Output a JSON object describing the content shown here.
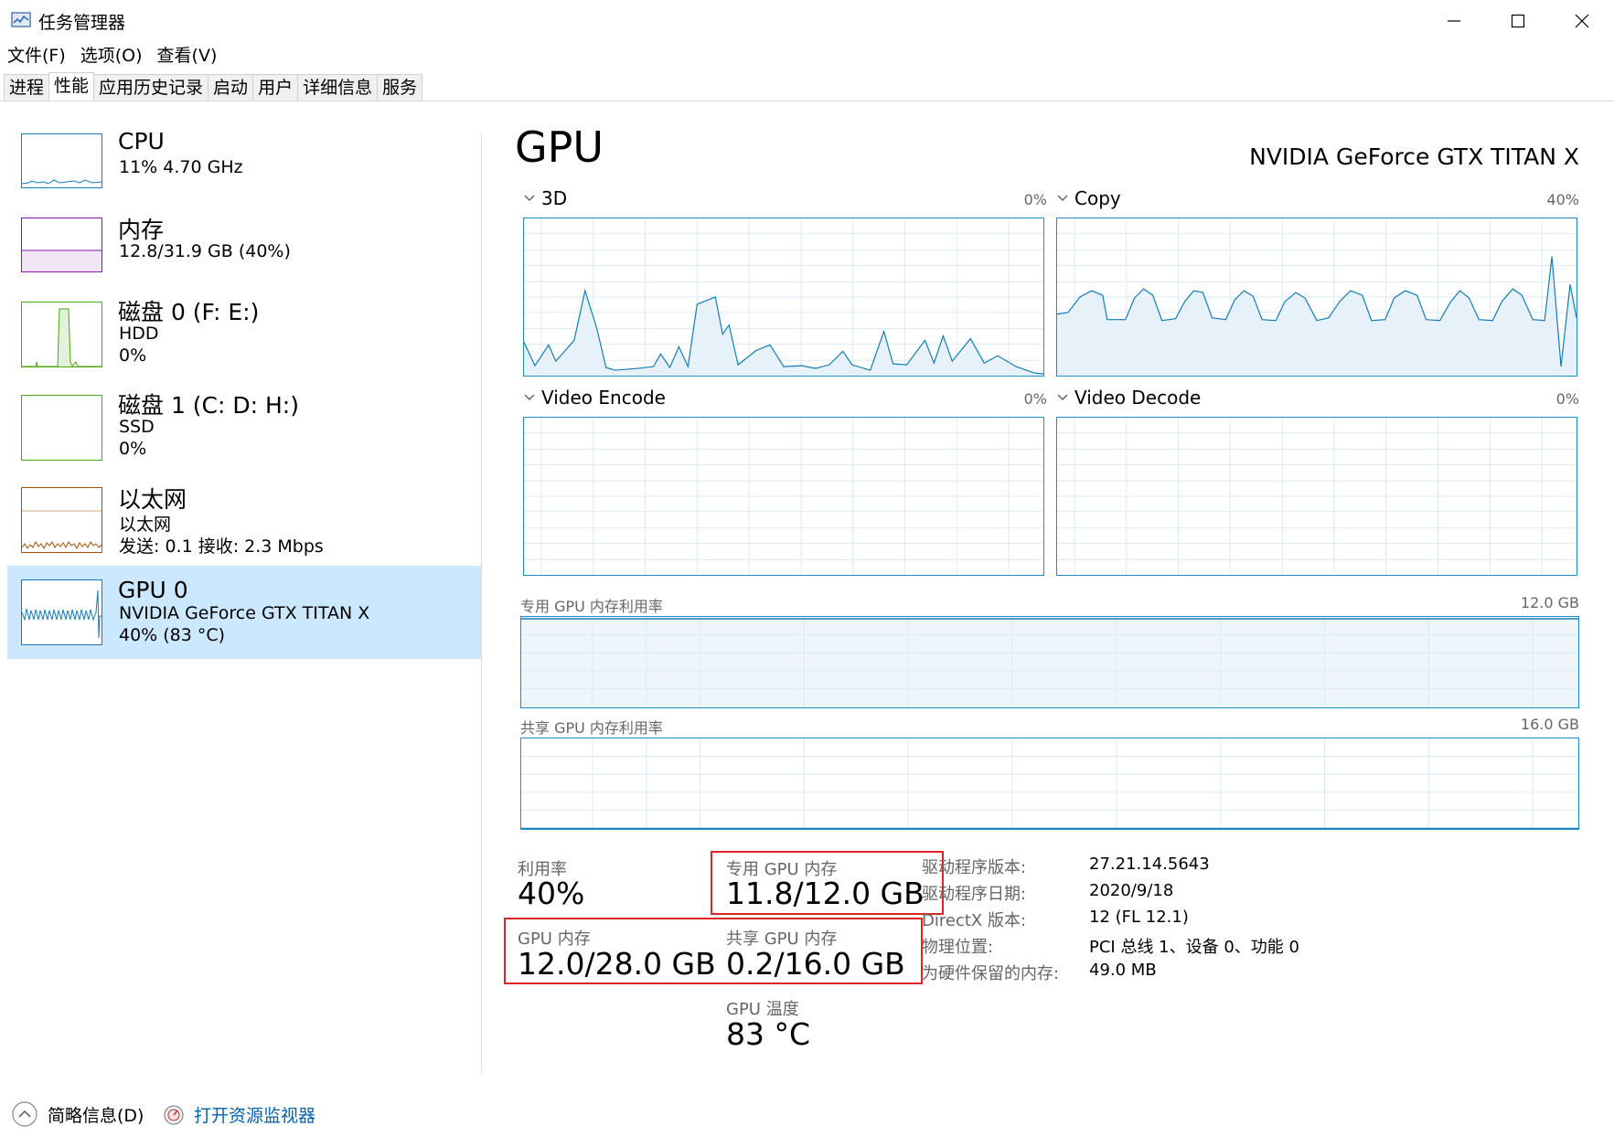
{
  "window": {
    "title": "任务管理器"
  },
  "menu": [
    "文件(F)",
    "选项(O)",
    "查看(V)"
  ],
  "tabs": [
    "进程",
    "性能",
    "应用历史记录",
    "启动",
    "用户",
    "详细信息",
    "服务"
  ],
  "sidebar": {
    "items": [
      {
        "title": "CPU",
        "lines": [
          "11%  4.70 GHz"
        ],
        "color": "#117dbb"
      },
      {
        "title": "内存",
        "lines": [
          "12.8/31.9 GB (40%)"
        ],
        "color": "#8b12ae"
      },
      {
        "title": "磁盘 0 (F: E:)",
        "lines": [
          "HDD",
          "0%"
        ],
        "color": "#4da60c"
      },
      {
        "title": "磁盘 1 (C: D: H:)",
        "lines": [
          "SSD",
          "0%"
        ],
        "color": "#4da60c"
      },
      {
        "title": "以太网",
        "lines": [
          "以太网",
          "发送: 0.1  接收: 2.3 Mbps"
        ],
        "color": "#a74f01"
      },
      {
        "title": "GPU 0",
        "lines": [
          "NVIDIA GeForce GTX TITAN X",
          "40% (83 °C)"
        ],
        "color": "#117dbb"
      }
    ]
  },
  "gpu": {
    "title": "GPU",
    "model": "NVIDIA GeForce GTX TITAN X",
    "engines": [
      {
        "name": "3D",
        "pct": "0%"
      },
      {
        "name": "Copy",
        "pct": "40%"
      },
      {
        "name": "Video Encode",
        "pct": "0%"
      },
      {
        "name": "Video Decode",
        "pct": "0%"
      }
    ],
    "dedicated_mem": {
      "label": "专用 GPU 内存利用率",
      "max": "12.0 GB",
      "fill": 0.98
    },
    "shared_mem": {
      "label": "共享 GPU 内存利用率",
      "max": "16.0 GB",
      "fill": 0.0125
    },
    "stats": {
      "utilization": {
        "label": "利用率",
        "value": "40%"
      },
      "dedicated": {
        "label": "专用 GPU 内存",
        "value": "11.8/12.0 GB"
      },
      "gpu_memory": {
        "label": "GPU 内存",
        "value": "12.0/28.0 GB"
      },
      "shared": {
        "label": "共享 GPU 内存",
        "value": "0.2/16.0 GB"
      },
      "temperature": {
        "label": "GPU 温度",
        "value": "83 °C"
      }
    },
    "properties": [
      {
        "label": "驱动程序版本:",
        "value": "27.21.14.5643"
      },
      {
        "label": "驱动程序日期:",
        "value": "2020/9/18"
      },
      {
        "label": "DirectX 版本:",
        "value": "12 (FL 12.1)"
      },
      {
        "label": "物理位置:",
        "value": "PCI 总线 1、设备 0、功能 0"
      },
      {
        "label": "为硬件保留的内存:",
        "value": "49.0 MB"
      }
    ]
  },
  "footer": {
    "summary": "简略信息(D)",
    "resmon": "打开资源监视器"
  },
  "accent_color": "#117dbb",
  "highlight_color": "#e02424"
}
